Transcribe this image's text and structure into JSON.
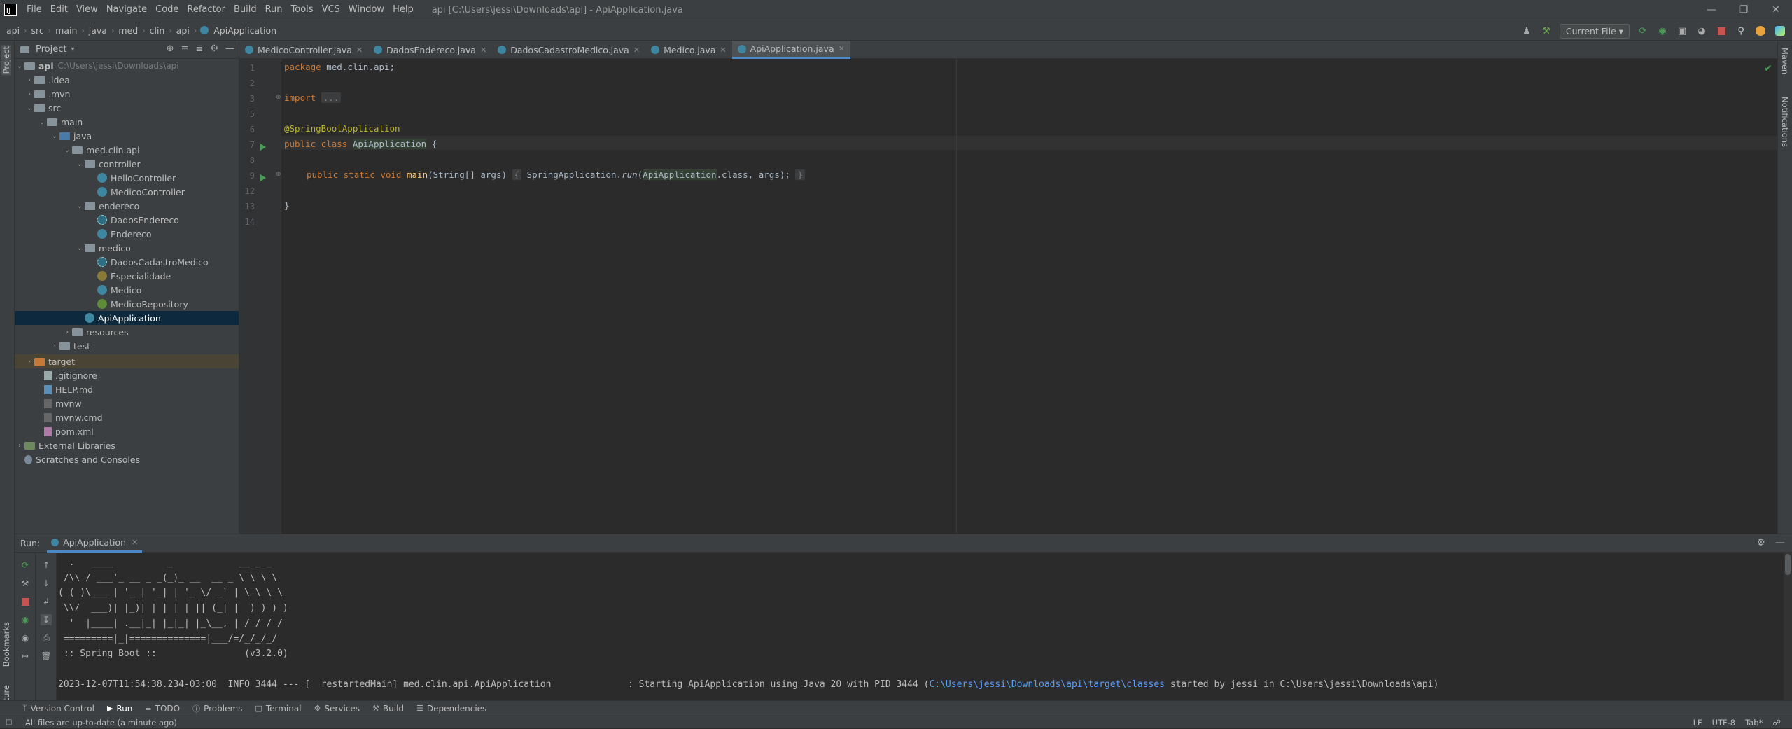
{
  "titlebar": {
    "logo": "IJ",
    "menu": [
      "File",
      "Edit",
      "View",
      "Navigate",
      "Code",
      "Refactor",
      "Build",
      "Run",
      "Tools",
      "VCS",
      "Window",
      "Help"
    ],
    "window_title": "api [C:\\Users\\jessi\\Downloads\\api] - ApiApplication.java"
  },
  "navbar": {
    "breadcrumbs": [
      "api",
      "src",
      "main",
      "java",
      "med",
      "clin",
      "api",
      "ApiApplication"
    ],
    "run_config": "Current File"
  },
  "left_strip": {
    "project": "Project",
    "bookmarks": "Bookmarks",
    "structure": "Structure"
  },
  "right_strip": {
    "maven": "Maven",
    "notifications": "Notifications"
  },
  "project_panel": {
    "title": "Project",
    "tree": [
      {
        "label": "api",
        "hint": "C:\\Users\\jessi\\Downloads\\api",
        "kind": "folder"
      },
      {
        "label": ".idea",
        "kind": "folder"
      },
      {
        "label": ".mvn",
        "kind": "folder"
      },
      {
        "label": "src",
        "kind": "folder"
      },
      {
        "label": "main",
        "kind": "folder"
      },
      {
        "label": "java",
        "kind": "folder"
      },
      {
        "label": "med.clin.api",
        "kind": "folder"
      },
      {
        "label": "controller",
        "kind": "folder"
      },
      {
        "label": "HelloController",
        "kind": "class"
      },
      {
        "label": "MedicoController",
        "kind": "class"
      },
      {
        "label": "endereco",
        "kind": "folder"
      },
      {
        "label": "DadosEndereco",
        "kind": "record"
      },
      {
        "label": "Endereco",
        "kind": "class"
      },
      {
        "label": "medico",
        "kind": "folder"
      },
      {
        "label": "DadosCadastroMedico",
        "kind": "record"
      },
      {
        "label": "Especialidade",
        "kind": "enum"
      },
      {
        "label": "Medico",
        "kind": "class"
      },
      {
        "label": "MedicoRepository",
        "kind": "interface"
      },
      {
        "label": "ApiApplication",
        "kind": "class"
      },
      {
        "label": "resources",
        "kind": "folder"
      },
      {
        "label": "test",
        "kind": "folder"
      },
      {
        "label": "target",
        "kind": "folder-orange"
      },
      {
        "label": ".gitignore",
        "kind": "file"
      },
      {
        "label": "HELP.md",
        "kind": "file"
      },
      {
        "label": "mvnw",
        "kind": "file"
      },
      {
        "label": "mvnw.cmd",
        "kind": "file"
      },
      {
        "label": "pom.xml",
        "kind": "file"
      },
      {
        "label": "External Libraries",
        "kind": "lib"
      },
      {
        "label": "Scratches and Consoles",
        "kind": "scratch"
      }
    ]
  },
  "tabs": [
    "MedicoController.java",
    "DadosEndereco.java",
    "DadosCadastroMedico.java",
    "Medico.java",
    "ApiApplication.java"
  ],
  "editor": {
    "line_numbers": [
      "1",
      "2",
      "3",
      "5",
      "6",
      "7",
      "8",
      "9",
      "12",
      "13",
      "14"
    ],
    "package_kw": "package",
    "package_name": "med.clin.api;",
    "import_kw": "import",
    "import_fold": "...",
    "annotation": "@SpringBootApplication",
    "class_decl_kw": "public class",
    "class_name": "ApiApplication",
    "class_open": "{",
    "method_kw": "public static void",
    "method_name": "main",
    "method_params": "(String[] args)",
    "method_body_open": "{",
    "method_body_call": "SpringApplication.",
    "method_body_run": "run",
    "method_body_arg": "ApiApplication",
    "method_body_rest": ".class, args);",
    "method_body_close": "}",
    "class_close": "}"
  },
  "run_window": {
    "label": "Run:",
    "tab": "ApiApplication",
    "banner": [
      "  .   ____          _            __ _ _",
      " /\\\\ / ___'_ __ _ _(_)_ __  __ _ \\ \\ \\ \\",
      "( ( )\\___ | '_ | '_| | '_ \\/ _` | \\ \\ \\ \\",
      " \\\\/  ___)| |_)| | | | | || (_| |  ) ) ) )",
      "  '  |____| .__|_| |_|_| |_\\__, | / / / /",
      " =========|_|==============|___/=/_/_/_/",
      " :: Spring Boot ::                (v3.2.0)",
      ""
    ],
    "log_prefix": "2023-12-07T11:54:38.234-03:00  INFO 3444 --- [  restartedMain] med.clin.api.ApiApplication              : Starting ApiApplication using Java 20 with PID 3444 (",
    "log_link": "C:\\Users\\jessi\\Downloads\\api\\target\\classes",
    "log_suffix": " started by jessi in C:\\Users\\jessi\\Downloads\\api)"
  },
  "bottom_bar": [
    "Version Control",
    "Run",
    "TODO",
    "Problems",
    "Terminal",
    "Services",
    "Build",
    "Dependencies"
  ],
  "status": {
    "message": "All files are up-to-date (a minute ago)",
    "line_sep": "LF",
    "encoding": "UTF-8",
    "indent": "Tab*"
  }
}
